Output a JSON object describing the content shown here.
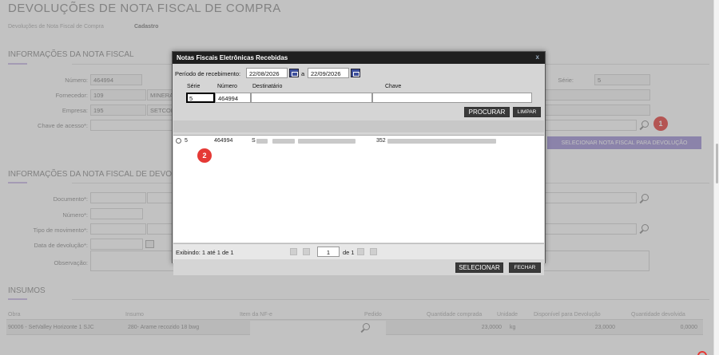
{
  "page": {
    "title": "DEVOLUÇÕES DE NOTA FISCAL DE COMPRA",
    "breadcrumb": [
      "Devoluções de Nota Fiscal de Compra",
      "Cadastro"
    ]
  },
  "nota_fiscal": {
    "section_title": "INFORMAÇÕES DA NOTA FISCAL",
    "numero_label": "Número:",
    "numero_value": "464994",
    "serie_label": "Série:",
    "serie_value": "5",
    "fornecedor_label": "Fornecedor:",
    "fornecedor_code": "109",
    "fornecedor_name": "MINERA",
    "empresa_label": "Empresa:",
    "empresa_code": "195",
    "empresa_name": "SETCOR",
    "chave_label": "Chave de acesso*:",
    "selecionar_button": "SELECIONAR NOTA FISCAL PARA DEVOLUÇÃO"
  },
  "devolucao": {
    "section_title": "INFORMAÇÕES DA NOTA FISCAL DE DEVOLUÇ",
    "documento_label": "Documento*:",
    "numero_label": "Número*:",
    "tipo_label": "Tipo de movimento*:",
    "data_label": "Data de devolução*:",
    "observacao_label": "Observação:"
  },
  "insumos": {
    "section_title": "INSUMOS",
    "columns": [
      "Obra",
      "Insumo",
      "Item da NF-e",
      "Pedido",
      "Quantidade comprada",
      "Unidade",
      "Disponível para Devolução",
      "Quantidade devolvida"
    ],
    "row": {
      "obra": "90006 - SetValley Horizonte 1 SJC",
      "insumo": "280- Arame recozido 18 bwg",
      "quantidade_comprada": "23,0000",
      "unidade": "kg",
      "disponivel": "23,0000",
      "devolvida": "0,0000"
    }
  },
  "dialog": {
    "title": "Notas Fiscais Eletrônicas Recebidas",
    "close": "x",
    "periodo_label": "Período de recebimento:",
    "date_from": "22/08/2026",
    "date_sep": "a",
    "date_to": "22/09/2026",
    "filter_headers": {
      "serie": "Série",
      "numero": "Número",
      "destinatario": "Destinatário",
      "chave": "Chave"
    },
    "filter_values": {
      "serie": "5",
      "numero": "464994",
      "destinatario": "",
      "chave": ""
    },
    "procurar_button": "PROCURAR",
    "limpar_button": "LIMPAR",
    "result_row": {
      "serie": "5",
      "numero": "464994",
      "destinatario": "S",
      "chave": "352"
    },
    "pager_text": "Exibindo: 1 até 1 de 1",
    "page_current": "1",
    "page_total": "de 1",
    "selecionar_button": "SELECIONAR",
    "fechar_button": "FECHAR"
  },
  "badges": {
    "one": "1",
    "two": "2"
  },
  "colors": {
    "accent": "#9b8cd4",
    "badge": "#e53935",
    "dialog_header": "#1f1f1f"
  }
}
